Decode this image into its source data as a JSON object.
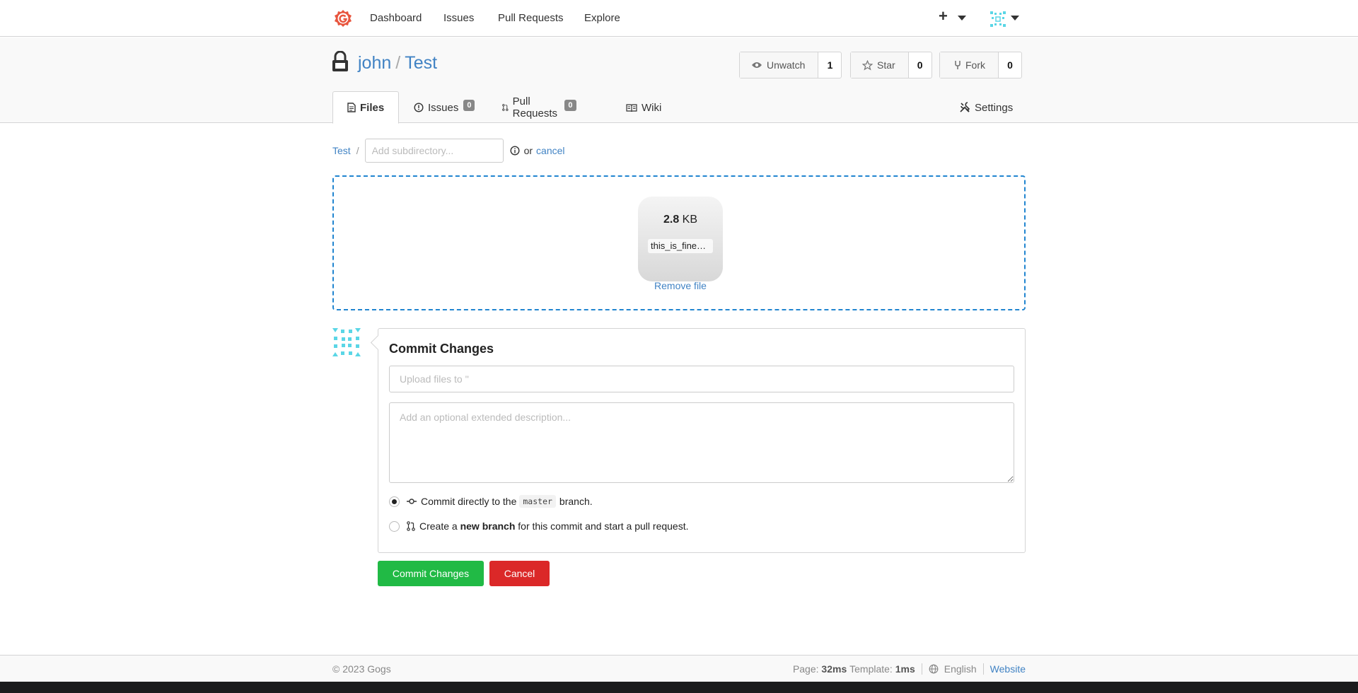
{
  "nav": {
    "items": [
      "Dashboard",
      "Issues",
      "Pull Requests",
      "Explore"
    ],
    "plus_label": "+"
  },
  "repo": {
    "owner": "john",
    "separator": "/",
    "name": "Test",
    "watch": {
      "label": "Unwatch",
      "count": "1"
    },
    "star": {
      "label": "Star",
      "count": "0"
    },
    "fork": {
      "label": "Fork",
      "count": "0"
    }
  },
  "tabs": {
    "files": "Files",
    "issues": "Issues",
    "issues_count": "0",
    "pulls": "Pull Requests",
    "pulls_count": "0",
    "wiki": "Wiki",
    "settings": "Settings"
  },
  "path": {
    "root": "Test",
    "slash": "/",
    "placeholder": "Add subdirectory...",
    "or": "or",
    "cancel": "cancel"
  },
  "upload": {
    "size_value": "2.8",
    "size_unit": "KB",
    "file_name": "this_is_fine_dog.png",
    "remove_label": "Remove file"
  },
  "commit": {
    "heading": "Commit Changes",
    "summary_placeholder": "Upload files to ''",
    "description_placeholder": "Add an optional extended description...",
    "option1_prefix": "Commit directly to the",
    "option1_branch": "master",
    "option1_suffix": "branch.",
    "option2_prefix": "Create a",
    "option2_bold": "new branch",
    "option2_suffix": "for this commit and start a pull request.",
    "submit_label": "Commit Changes",
    "cancel_label": "Cancel"
  },
  "footer": {
    "copyright": "© 2023 Gogs",
    "page_label": "Page:",
    "page_time": "32ms",
    "template_label": "Template:",
    "template_time": "1ms",
    "language": "English",
    "website": "Website"
  },
  "colors": {
    "primary_link": "#4183c4",
    "dropzone_border": "#2185d0",
    "commit_button": "#21ba45",
    "cancel_button": "#db2828",
    "logo": "#e8553e"
  }
}
